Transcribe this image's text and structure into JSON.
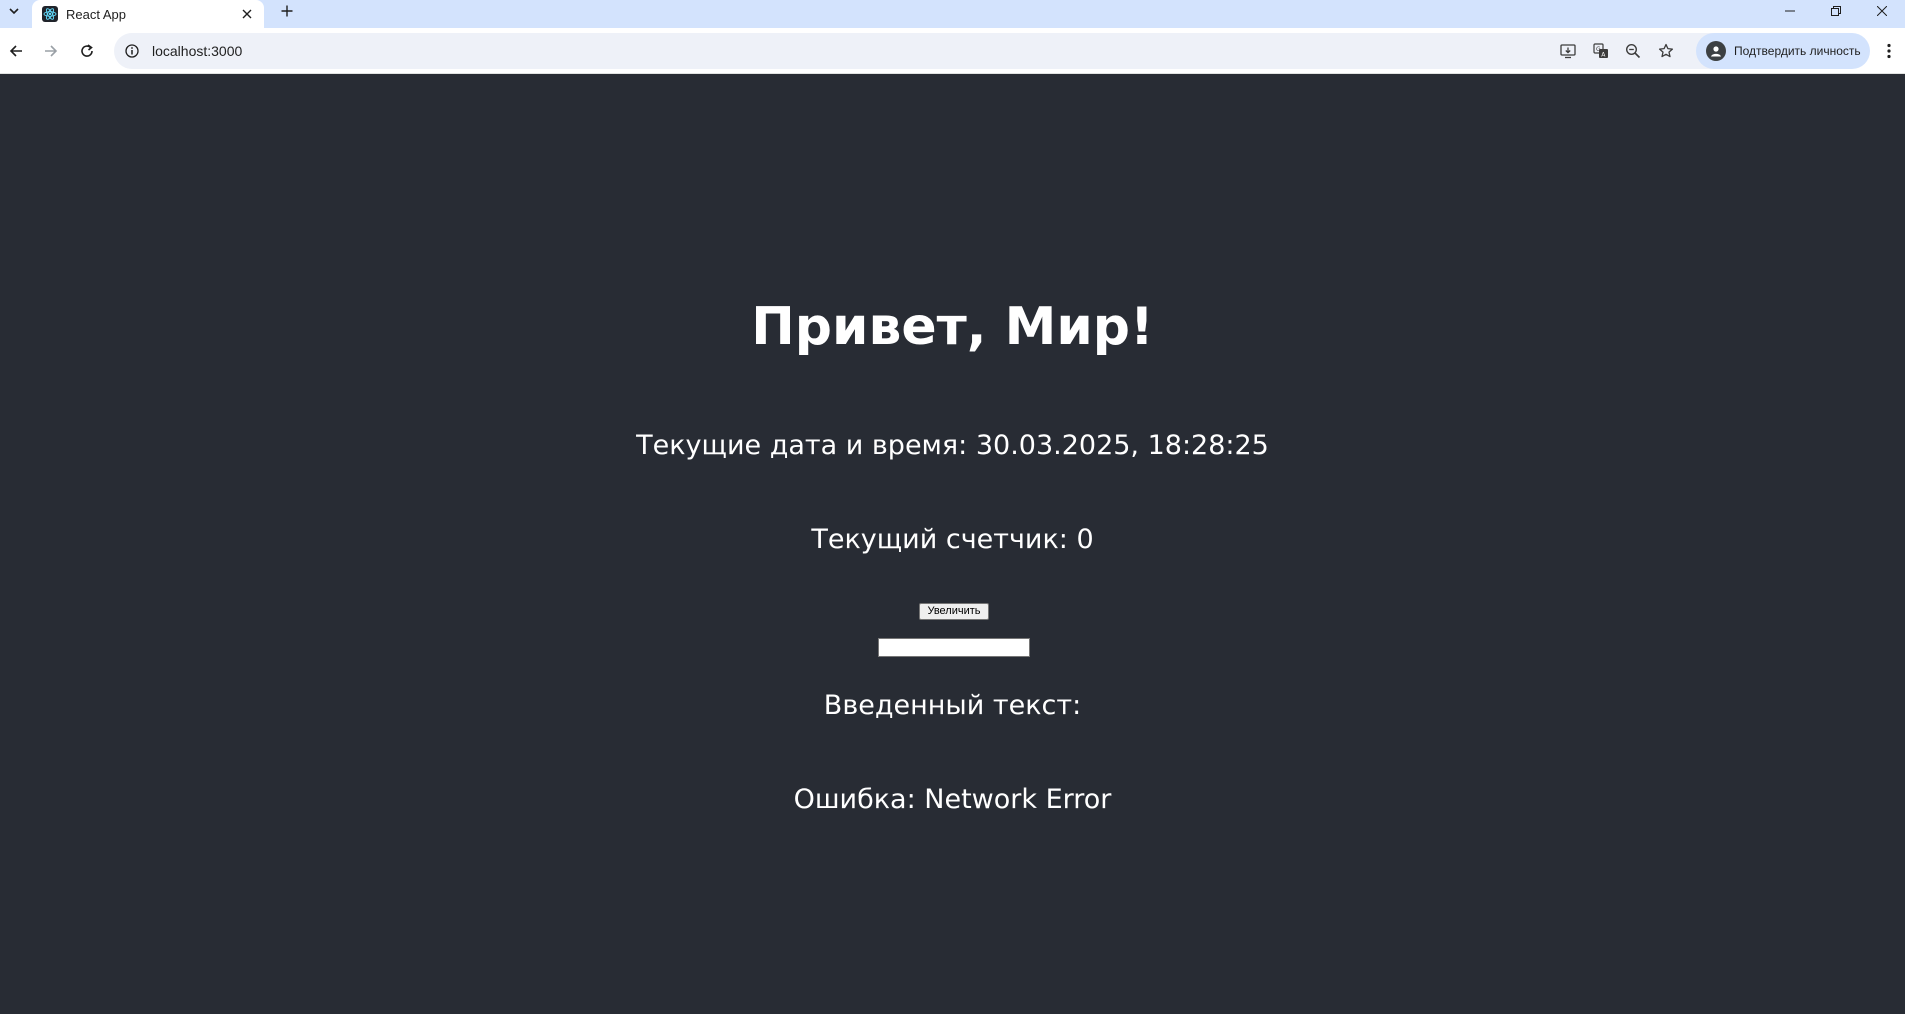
{
  "browser": {
    "tab": {
      "title": "React App",
      "favicon": "react-logo-icon"
    },
    "address_bar": {
      "url": "localhost:3000"
    },
    "profile": {
      "label": "Подтвердить личность"
    },
    "colors": {
      "tab_strip": "#d3e3fd",
      "toolbar": "#ffffff",
      "omnibox": "#eef1f8"
    }
  },
  "page": {
    "title": "Привет, Мир!",
    "datetime_line": "Текущие дата и время: 30.03.2025, 18:28:25",
    "counter_line": "Текущий счетчик: 0",
    "increment_button_label": "Увеличить",
    "text_input": {
      "value": "",
      "placeholder": ""
    },
    "entered_text_line": "Введенный текст:",
    "error_line": "Ошибка: Network Error",
    "colors": {
      "background": "#282c34",
      "text": "#ffffff"
    }
  }
}
